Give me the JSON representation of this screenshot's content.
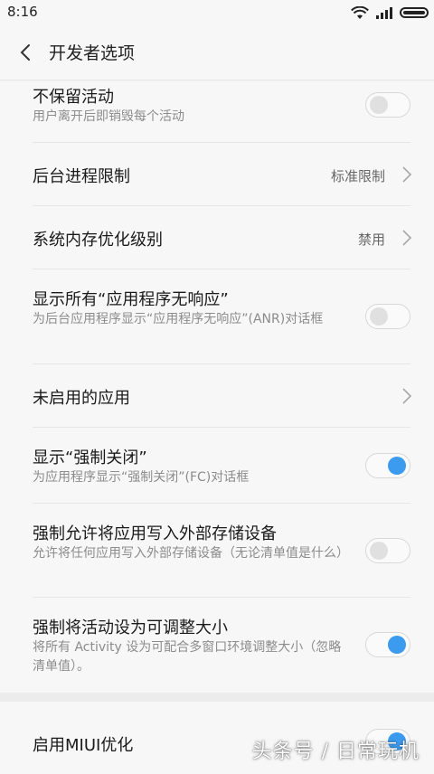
{
  "status_bar": {
    "time": "8:16"
  },
  "header": {
    "title": "开发者选项"
  },
  "settings": [
    {
      "title": "不保留活动",
      "subtitle": "用户离开后即销毁每个活动",
      "toggle": false
    },
    {
      "title": "后台进程限制",
      "value": "标准限制"
    },
    {
      "title": "系统内存优化级别",
      "value": "禁用"
    },
    {
      "title": "显示所有“应用程序无响应”",
      "subtitle": "为后台应用程序显示“应用程序无响应”(ANR)对话框",
      "toggle": false
    },
    {
      "title": "未启用的应用"
    },
    {
      "title": "显示“强制关闭”",
      "subtitle": "为应用程序显示“强制关闭”(FC)对话框",
      "toggle": true
    },
    {
      "title": "强制允许将应用写入外部存储设备",
      "subtitle": "允许将任何应用写入外部存储设备（无论清单值是什么）",
      "toggle": false
    },
    {
      "title": "强制将活动设为可调整大小",
      "subtitle": "将所有 Activity 设为可配合多窗口环境调整大小（忽略清单值）。",
      "toggle": true
    }
  ],
  "miui": {
    "title": "启用MIUI优化",
    "toggle": true
  },
  "watermark": "头条号 / 日常玩机",
  "colors": {
    "accent": "#3d9bef",
    "background": "#f7f7f7"
  }
}
